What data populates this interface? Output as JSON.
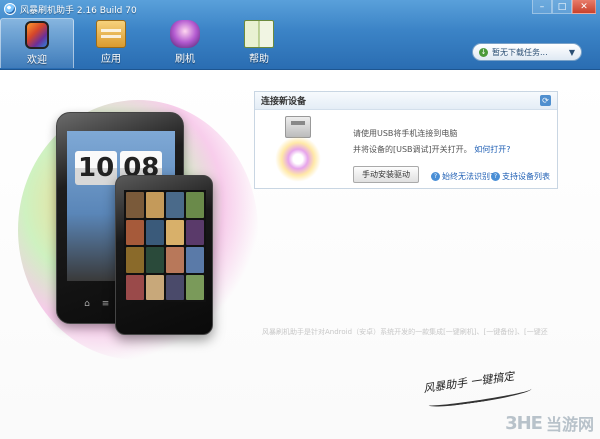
{
  "window": {
    "title": "风暴刷机助手 2.16 Build 70",
    "controls": [
      "–",
      "□",
      "✕"
    ]
  },
  "nav": {
    "items": [
      {
        "label": "欢迎",
        "icon": "phone-icon",
        "active": true
      },
      {
        "label": "应用",
        "icon": "apps-box-icon",
        "active": false
      },
      {
        "label": "刷机",
        "icon": "flash-phone-icon",
        "active": false
      },
      {
        "label": "帮助",
        "icon": "help-book-icon",
        "active": false
      }
    ]
  },
  "tasks": {
    "dropdown_label": "暂无下载任务..."
  },
  "phone_art": {
    "clock_digits": [
      "10",
      "08"
    ]
  },
  "connect": {
    "title": "连接新设备",
    "line1": "请使用USB将手机连接到电脑",
    "line2_prefix": "并将设备的[USB调试]开关打开。",
    "line2_link": "如何打开?",
    "install_button": "手动安装驱动",
    "link_unrecognized": "始终无法识别?",
    "link_supported": "支持设备列表"
  },
  "footer": {
    "description": "风暴刷机助手是针对Android（安卓）系统开发的一款集成[一键刷机]、[一键备份]、[一键还",
    "slogan": "风暴助手 一键搞定",
    "watermark_logo": "3HE",
    "watermark_text": "当游网"
  },
  "colors": {
    "toolbar_top": "#5aa0da",
    "toolbar_bottom": "#2a6db2",
    "link": "#1f5fb4"
  }
}
